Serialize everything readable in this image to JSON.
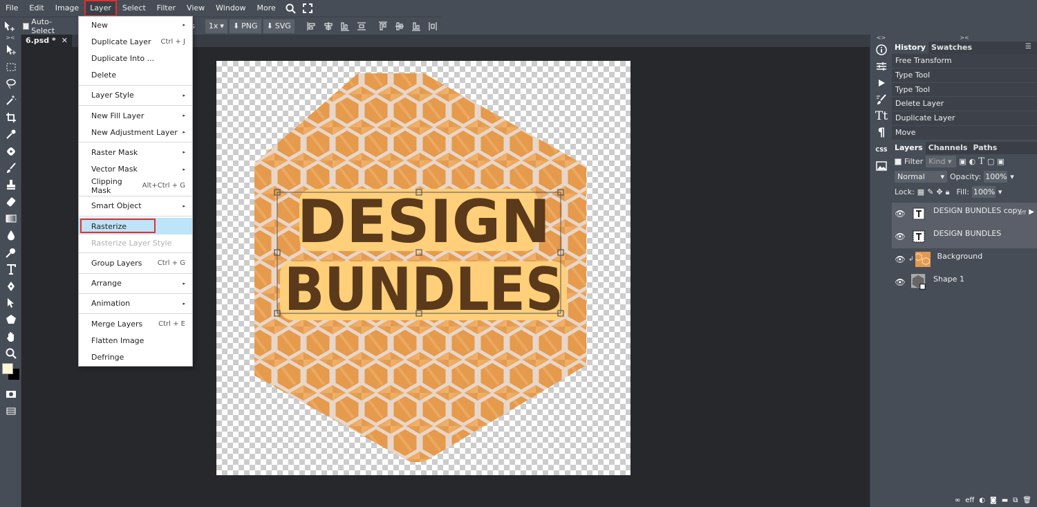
{
  "menubar": {
    "items": [
      "File",
      "Edit",
      "Image",
      "Layer",
      "Select",
      "Filter",
      "View",
      "Window",
      "More"
    ],
    "active": "Layer"
  },
  "options": {
    "auto_select_label": "Auto-Select",
    "partial_label": "es",
    "scale_label": "1x",
    "png_label": "PNG",
    "svg_label": "SVG"
  },
  "document": {
    "tab_title": "6.psd *",
    "tab_close": "✕",
    "line1": "DESIGN",
    "line2": "BUNDLES"
  },
  "layer_menu": {
    "items": [
      {
        "label": "New",
        "shortcut": "",
        "submenu": true
      },
      {
        "label": "Duplicate Layer",
        "shortcut": "Ctrl + J",
        "submenu": false
      },
      {
        "label": "Duplicate Into ...",
        "shortcut": "",
        "submenu": false
      },
      {
        "label": "Delete",
        "shortcut": "",
        "submenu": false
      },
      {
        "label": "Layer Style",
        "shortcut": "",
        "submenu": true
      },
      {
        "label": "New Fill Layer",
        "shortcut": "",
        "submenu": true
      },
      {
        "label": "New Adjustment Layer",
        "shortcut": "",
        "submenu": true
      },
      {
        "label": "Raster Mask",
        "shortcut": "",
        "submenu": true
      },
      {
        "label": "Vector Mask",
        "shortcut": "",
        "submenu": true
      },
      {
        "label": "Clipping Mask",
        "shortcut": "Alt+Ctrl + G",
        "submenu": false
      },
      {
        "label": "Smart Object",
        "shortcut": "",
        "submenu": true
      },
      {
        "label": "Rasterize",
        "shortcut": "",
        "submenu": false
      },
      {
        "label": "Rasterize Layer Style",
        "shortcut": "",
        "submenu": false
      },
      {
        "label": "Group Layers",
        "shortcut": "Ctrl + G",
        "submenu": false
      },
      {
        "label": "Arrange",
        "shortcut": "",
        "submenu": true
      },
      {
        "label": "Animation",
        "shortcut": "",
        "submenu": true
      },
      {
        "label": "Merge Layers",
        "shortcut": "Ctrl + E",
        "submenu": false
      },
      {
        "label": "Flatten Image",
        "shortcut": "",
        "submenu": false
      },
      {
        "label": "Defringe",
        "shortcut": "",
        "submenu": false
      }
    ],
    "submenu_arrow": "▸"
  },
  "history_panel": {
    "tabs": [
      "History",
      "Swatches"
    ],
    "items": [
      "Free Transform",
      "Type Tool",
      "Type Tool",
      "Delete Layer",
      "Duplicate Layer",
      "Move"
    ]
  },
  "layers_panel": {
    "tabs": [
      "Layers",
      "Channels",
      "Paths"
    ],
    "filter_label": "Filter",
    "kind_label": "Kind",
    "blend_mode": "Normal",
    "opacity_label": "Opacity:",
    "opacity_value": "100%",
    "lock_label": "Lock:",
    "fill_label": "Fill:",
    "fill_value": "100%",
    "eff_label": "eff",
    "layers": [
      {
        "name": "DESIGN BUNDLES copy",
        "type": "text",
        "selected": true
      },
      {
        "name": "DESIGN BUNDLES",
        "type": "text",
        "selected": true
      },
      {
        "name": "Background",
        "type": "image",
        "selected": false
      },
      {
        "name": "Shape 1",
        "type": "shape",
        "selected": false
      }
    ]
  },
  "iconcol": {
    "type_icon": "Tt",
    "para_icon": "¶",
    "css_icon": "CSS"
  },
  "colors": {
    "menu_highlight_outline": "#e03030",
    "selection_bg": "#bde4f8",
    "honey": "#e8a157",
    "text_brown": "#5a3a1a",
    "text_highlight": "#ffcf7a"
  }
}
